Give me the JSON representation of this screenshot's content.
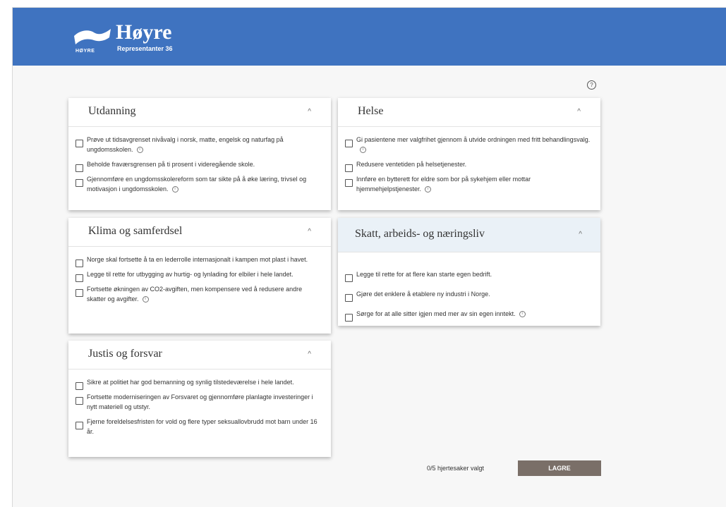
{
  "brand": {
    "logo_text": "HØYRE",
    "name": "Høyre",
    "subtitle": "Representanter 36"
  },
  "help_icon": "?",
  "info_icon": "i",
  "chevron": "^",
  "cards": {
    "utdanning": {
      "title": "Utdanning",
      "items": [
        {
          "text": "Prøve ut tidsavgrenset nivåvalg i norsk, matte, engelsk og naturfag på ungdomsskolen.",
          "info": true
        },
        {
          "text": "Beholde fraværsgrensen på ti prosent i videregående skole.",
          "info": false
        },
        {
          "text": "Gjennomføre en ungdomsskolereform som tar sikte på å øke læring, trivsel og motivasjon i ungdomsskolen.",
          "info": true
        }
      ]
    },
    "helse": {
      "title": "Helse",
      "items": [
        {
          "text": "Gi pasientene mer valgfrihet gjennom å utvide ordningen med fritt behandlingsvalg.",
          "info": true
        },
        {
          "text": "Redusere ventetiden på helsetjenester.",
          "info": false
        },
        {
          "text": "Innføre en bytterett for eldre som bor på sykehjem eller mottar hjemmehjelpstjenester.",
          "info": true
        }
      ]
    },
    "klima": {
      "title": "Klima og samferdsel",
      "items": [
        {
          "text": "Norge skal fortsette å ta en lederrolle internasjonalt i kampen mot plast i havet.",
          "info": false
        },
        {
          "text": "Legge til rette for utbygging av hurtig- og lynlading for elbiler i hele landet.",
          "info": false
        },
        {
          "text": "Fortsette økningen av CO2-avgiften, men kompensere ved å redusere andre skatter og avgifter.",
          "info": true
        }
      ]
    },
    "skatt": {
      "title": "Skatt, arbeids- og næringsliv",
      "items": [
        {
          "text": "Legge til rette for at flere kan starte egen bedrift.",
          "info": false
        },
        {
          "text": "Gjøre det enklere å etablere ny industri i Norge.",
          "info": false
        },
        {
          "text": "Sørge for at alle sitter igjen med mer av sin egen inntekt.",
          "info": true
        }
      ]
    },
    "justis": {
      "title": "Justis og forsvar",
      "items": [
        {
          "text": "Sikre at politiet har god bemanning og synlig tilstedeværelse i hele landet.",
          "info": false
        },
        {
          "text": "Fortsette moderniseringen av Forsvaret og gjennomføre planlagte investeringer i nytt materiell og utstyr.",
          "info": false
        },
        {
          "text": "Fjerne foreldelsesfristen for vold og flere typer seksuallovbrudd mot barn under 16 år.",
          "info": false
        }
      ]
    }
  },
  "footer": {
    "counter": "0/5 hjertesaker valgt",
    "save_label": "LAGRE"
  }
}
